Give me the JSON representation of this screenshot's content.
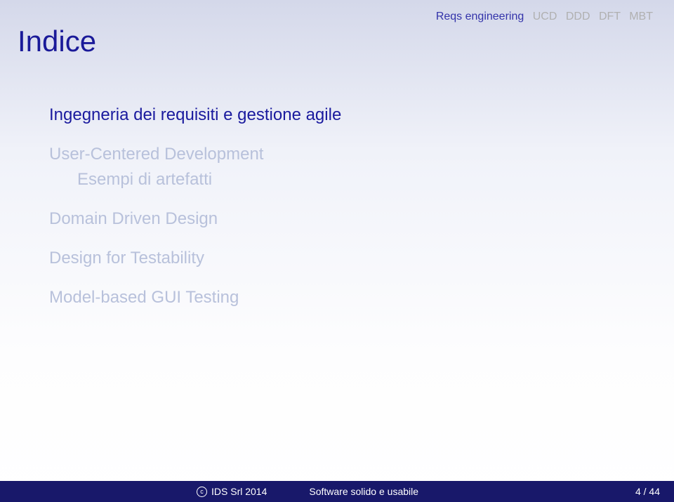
{
  "nav": {
    "items": [
      {
        "label": "Reqs engineering",
        "active": true
      },
      {
        "label": "UCD",
        "active": false
      },
      {
        "label": "DDD",
        "active": false
      },
      {
        "label": "DFT",
        "active": false
      },
      {
        "label": "MBT",
        "active": false
      }
    ]
  },
  "title": "Indice",
  "toc": {
    "items": [
      {
        "label": "Ingegneria dei requisiti e gestione agile",
        "active": true,
        "subitems": []
      },
      {
        "label": "User-Centered Development",
        "active": false,
        "subitems": [
          "Esempi di artefatti"
        ]
      },
      {
        "label": "Domain Driven Design",
        "active": false,
        "subitems": []
      },
      {
        "label": "Design for Testability",
        "active": false,
        "subitems": []
      },
      {
        "label": "Model-based GUI Testing",
        "active": false,
        "subitems": []
      }
    ]
  },
  "footer": {
    "copyright": "IDS Srl 2014",
    "title": "Software solido e usabile",
    "page": "4 / 44"
  }
}
